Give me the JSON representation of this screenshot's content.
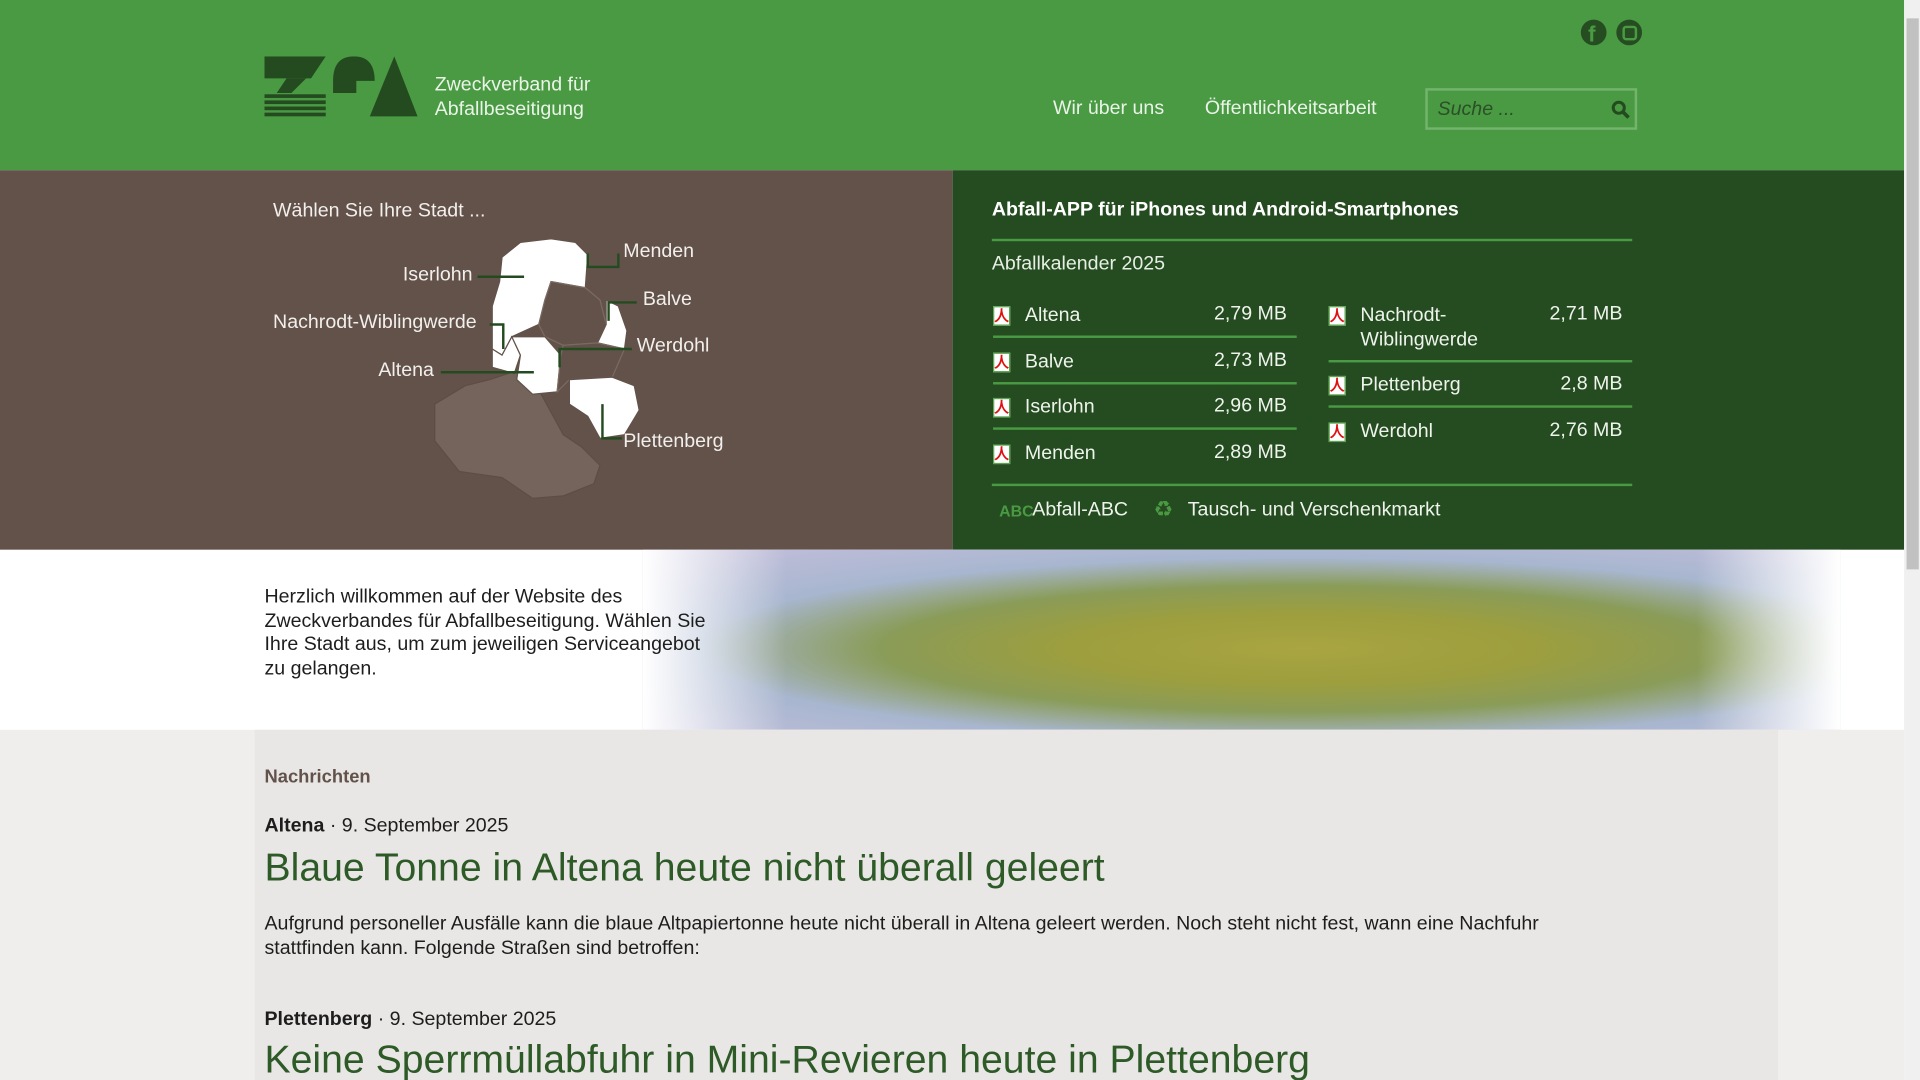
{
  "header": {
    "logo_text": "ZfA",
    "org_name_line1": "Zweckverband für",
    "org_name_line2": "Abfallbeseitigung",
    "nav": [
      "Wir über uns",
      "Öffentlichkeitsarbeit"
    ],
    "search_placeholder": "Suche ...",
    "social": [
      "facebook-icon",
      "instagram-icon"
    ]
  },
  "map": {
    "prompt": "Wählen Sie Ihre Stadt ...",
    "cities": [
      "Menden",
      "Iserlohn",
      "Balve",
      "Nachrodt-Wiblingwerde",
      "Werdohl",
      "Altena",
      "Plettenberg"
    ]
  },
  "downloads": {
    "app_title": "Abfall-APP für iPhones und Android-Smartphones",
    "calendar_title": "Abfallkalender 2025",
    "left": [
      {
        "name": "Altena",
        "size": "2,79 MB"
      },
      {
        "name": "Balve",
        "size": "2,73 MB"
      },
      {
        "name": "Iserlohn",
        "size": "2,96 MB"
      },
      {
        "name": "Menden",
        "size": "2,89 MB"
      }
    ],
    "right": [
      {
        "name": "Nachrodt-Wiblingwerde",
        "size": "2,71 MB"
      },
      {
        "name": "Plettenberg",
        "size": "2,8 MB"
      },
      {
        "name": "Werdohl",
        "size": "2,76 MB"
      }
    ],
    "links": [
      "Abfall-ABC",
      "Tausch- und Verschenkmarkt"
    ]
  },
  "welcome": "Herzlich willkommen auf der Website des Zweckverbandes für Abfallbeseitigung. Wählen Sie Ihre Stadt aus, um zum jeweiligen Serviceangebot zu gelangen.",
  "news": {
    "heading": "Nachrichten",
    "items": [
      {
        "city": "Altena",
        "date": "· 9. September 2025",
        "title": "Blaue Tonne in Altena heute nicht überall geleert",
        "text": "Aufgrund personeller Ausfälle kann die blaue Altpapiertonne heute nicht überall in Altena geleert werden. Noch steht nicht fest, wann eine Nachfuhr stattfinden kann. Folgende Straßen sind betroffen:"
      },
      {
        "city": "Plettenberg",
        "date": "· 9. September 2025",
        "title": "Keine Sperrmüllabfuhr in Mini-Revieren heute in Plettenberg"
      }
    ]
  },
  "colors": {
    "header": "#4a9a43",
    "dark": "#254b20",
    "brown": "#62524a",
    "headline": "#2d5a27"
  }
}
